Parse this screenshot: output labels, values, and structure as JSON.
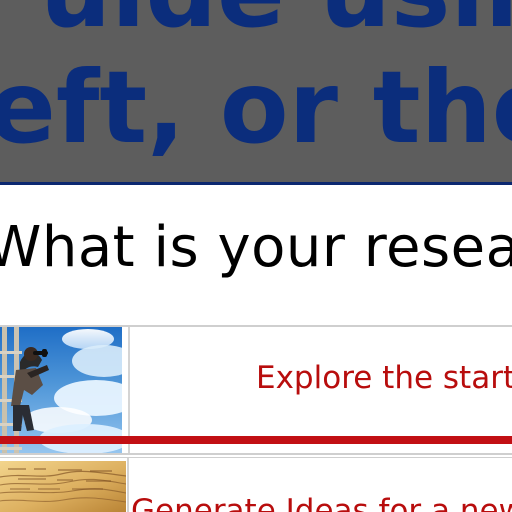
{
  "banner": {
    "line_1": "uide using",
    "line_2": "eft, or the e"
  },
  "research_question": "What is your researc",
  "rows": [
    {
      "link_text": "Explore the start",
      "image_icon": "explorer-on-ladder-image"
    },
    {
      "link_text": "Generate Ideas for a new",
      "image_icon": "old-manuscript-image"
    }
  ],
  "colors": {
    "banner_background": "#5d5d5d",
    "banner_text": "#0b2d7c",
    "accent_bar": "#c20f14",
    "link_text": "#b80d0d"
  }
}
